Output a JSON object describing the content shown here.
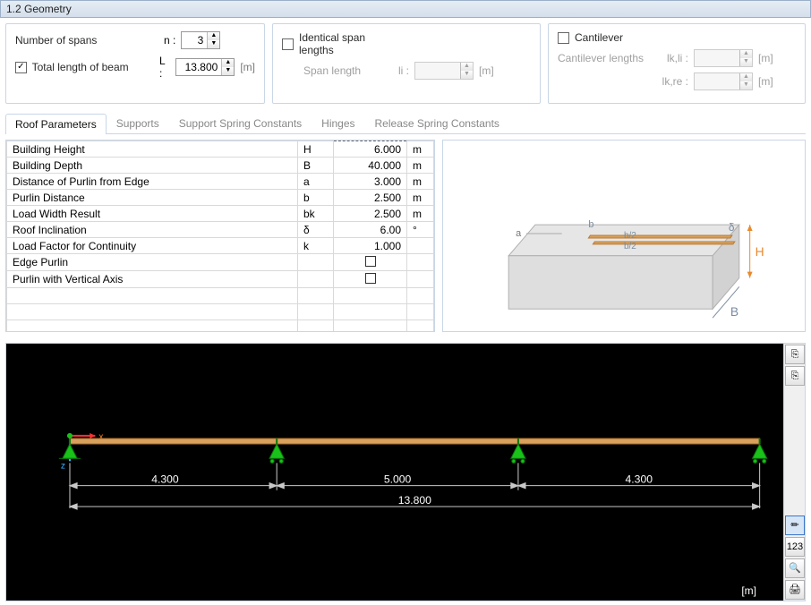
{
  "window": {
    "title": "1.2 Geometry"
  },
  "top": {
    "spans_label": "Number of spans",
    "n_label": "n :",
    "n_value": "3",
    "total_len_label": "Total length of beam",
    "l_label": "L :",
    "l_value": "13.800",
    "l_unit": "[m]",
    "identical_label": "Identical span lengths",
    "span_len_label": "Span length",
    "li_label": "li :",
    "li_value": "",
    "li_unit": "[m]",
    "cantilever_label": "Cantilever",
    "cant_len_label": "Cantilever lengths",
    "lk_li_label": "lk,li :",
    "lk_li_value": "",
    "lk_li_unit": "[m]",
    "lk_re_label": "lk,re :",
    "lk_re_value": "",
    "lk_re_unit": "[m]"
  },
  "tabs": {
    "t0": "Roof Parameters",
    "t1": "Supports",
    "t2": "Support Spring Constants",
    "t3": "Hinges",
    "t4": "Release Spring Constants"
  },
  "params": [
    {
      "name": "Building Height",
      "sym": "H",
      "val": "6.000",
      "unit": "m"
    },
    {
      "name": "Building Depth",
      "sym": "B",
      "val": "40.000",
      "unit": "m"
    },
    {
      "name": "Distance of Purlin from Edge",
      "sym": "a",
      "val": "3.000",
      "unit": "m"
    },
    {
      "name": "Purlin Distance",
      "sym": "b",
      "val": "2.500",
      "unit": "m"
    },
    {
      "name": "Load Width Result",
      "sym": "bk",
      "val": "2.500",
      "unit": "m"
    },
    {
      "name": "Roof Inclination",
      "sym": "δ",
      "val": "6.00",
      "unit": "°"
    },
    {
      "name": "Load Factor for Continuity",
      "sym": "k",
      "val": "1.000",
      "unit": ""
    },
    {
      "name": "Edge Purlin",
      "sym": "",
      "val": "",
      "unit": "",
      "cb": true
    },
    {
      "name": "Purlin with Vertical Axis",
      "sym": "",
      "val": "",
      "unit": "",
      "cb": true
    }
  ],
  "diagram": {
    "a": "a",
    "b": "b",
    "b2a": "b/2",
    "b2b": "b/2",
    "delta": "δ",
    "H": "H",
    "B": "B"
  },
  "beam": {
    "span1": "4.300",
    "span2": "5.000",
    "span3": "4.300",
    "total": "13.800",
    "unit": "[m]"
  },
  "toolbar": {
    "copy": "⎘",
    "paste": "⎘",
    "t1": "✏",
    "t2": "123",
    "t3": "🔍",
    "t4": "🖨"
  }
}
